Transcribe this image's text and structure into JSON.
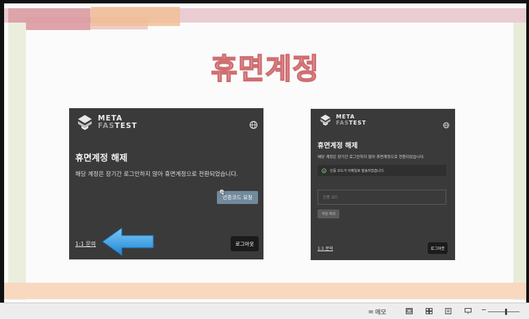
{
  "slide": {
    "title": "휴면계정",
    "colors": {
      "title_fill": "#f4c9c9",
      "title_stroke": "#cf6f72",
      "panel_bg": "#3b3a3b",
      "request_button": "#718a9c",
      "arrow": "#3aa7ea"
    }
  },
  "left_panel": {
    "logo_line1": "META",
    "logo_line2a": "FAS",
    "logo_line2b": "TEST",
    "globe_icon": "globe-icon",
    "heading": "휴면계정 해제",
    "description": "해당 계정은 장기간 로그인하지 않아 휴면계정으로 전환되었습니다.",
    "request_code_button": "인증코드 요청",
    "inquiry_link": "1:1 문의",
    "logout_button": "로그아웃"
  },
  "right_panel": {
    "logo_line1": "META",
    "logo_line2a": "FAS",
    "logo_line2b": "TEST",
    "globe_icon": "globe-icon",
    "heading": "휴면계정 해제",
    "description": "해당 계정은 장기간 로그인하지 않아 휴면계정으로 전환되었습니다.",
    "notice": "인증 코드가 이메일로 발송되었습니다.",
    "code_placeholder": "인증 코드",
    "unlock_button": "계정 해제",
    "inquiry_link": "1:1 문의",
    "logout_button": "로그아웃"
  },
  "statusbar": {
    "memo_label": "메모"
  }
}
